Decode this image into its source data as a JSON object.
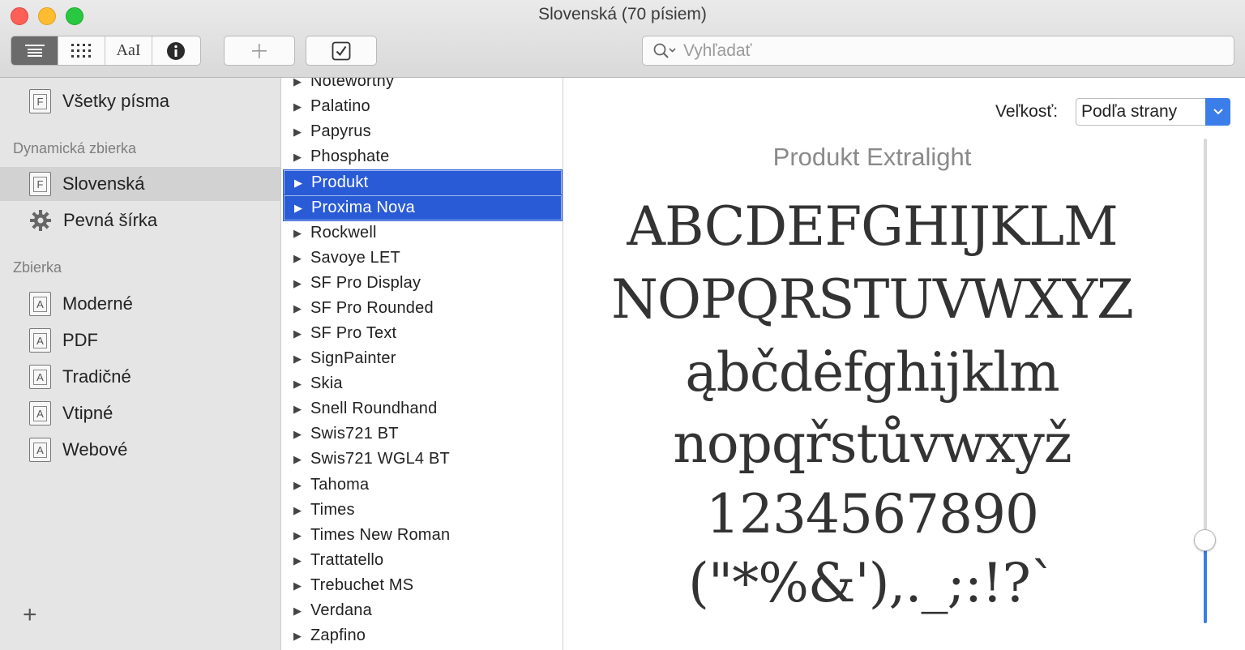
{
  "window": {
    "title": "Slovenská (70 písiem)"
  },
  "toolbar": {
    "view_buttons": [
      {
        "icon": "list-view-icon"
      },
      {
        "icon": "grid-view-icon"
      },
      {
        "label": "AaI",
        "icon": "sample-text-icon"
      },
      {
        "icon": "info-icon"
      }
    ],
    "add_icon": "plus-icon",
    "validate_icon": "checkbox-icon",
    "search": {
      "placeholder": "Vyhľadať",
      "value": ""
    }
  },
  "sidebar": {
    "all_fonts": {
      "label": "Všetky písma"
    },
    "dynamic_header": "Dynamická zbierka",
    "dynamic_items": [
      {
        "label": "Slovenská",
        "selected": true
      },
      {
        "label": "Pevná šírka"
      }
    ],
    "collection_header": "Zbierka",
    "collection_items": [
      {
        "label": "Moderné"
      },
      {
        "label": "PDF"
      },
      {
        "label": "Tradičné"
      },
      {
        "label": "Vtipné"
      },
      {
        "label": "Webové"
      }
    ],
    "add_label": "+"
  },
  "font_list": {
    "items": [
      {
        "name": "Noteworthy"
      },
      {
        "name": "Palatino"
      },
      {
        "name": "Papyrus"
      },
      {
        "name": "Phosphate"
      },
      {
        "name": "Produkt",
        "selected": true
      },
      {
        "name": "Proxima Nova",
        "selected": true
      },
      {
        "name": "Rockwell"
      },
      {
        "name": "Savoye LET"
      },
      {
        "name": "SF Pro Display"
      },
      {
        "name": "SF Pro Rounded"
      },
      {
        "name": "SF Pro Text"
      },
      {
        "name": "SignPainter"
      },
      {
        "name": "Skia"
      },
      {
        "name": "Snell Roundhand"
      },
      {
        "name": "Swis721 BT"
      },
      {
        "name": "Swis721 WGL4 BT"
      },
      {
        "name": "Tahoma"
      },
      {
        "name": "Times"
      },
      {
        "name": "Times New Roman"
      },
      {
        "name": "Trattatello"
      },
      {
        "name": "Trebuchet MS"
      },
      {
        "name": "Verdana"
      },
      {
        "name": "Zapfino"
      }
    ]
  },
  "preview": {
    "size_label": "Veľkosť:",
    "size_value": "Podľa strany",
    "font_name": "Produkt Extralight",
    "sample_lines": [
      "ABCDEFGHIJKLM",
      "NOPQRSTUVWXYZ",
      "ąbčdėfghijklm",
      "nopqřstůvwxyž",
      "1234567890",
      "(\"*%&'),._;:!?`"
    ],
    "size_slider_level": 0.17
  },
  "colors": {
    "selection": "#2a5bd7",
    "accent": "#3b7de9",
    "sidebar_bg": "#e5e5e5"
  }
}
